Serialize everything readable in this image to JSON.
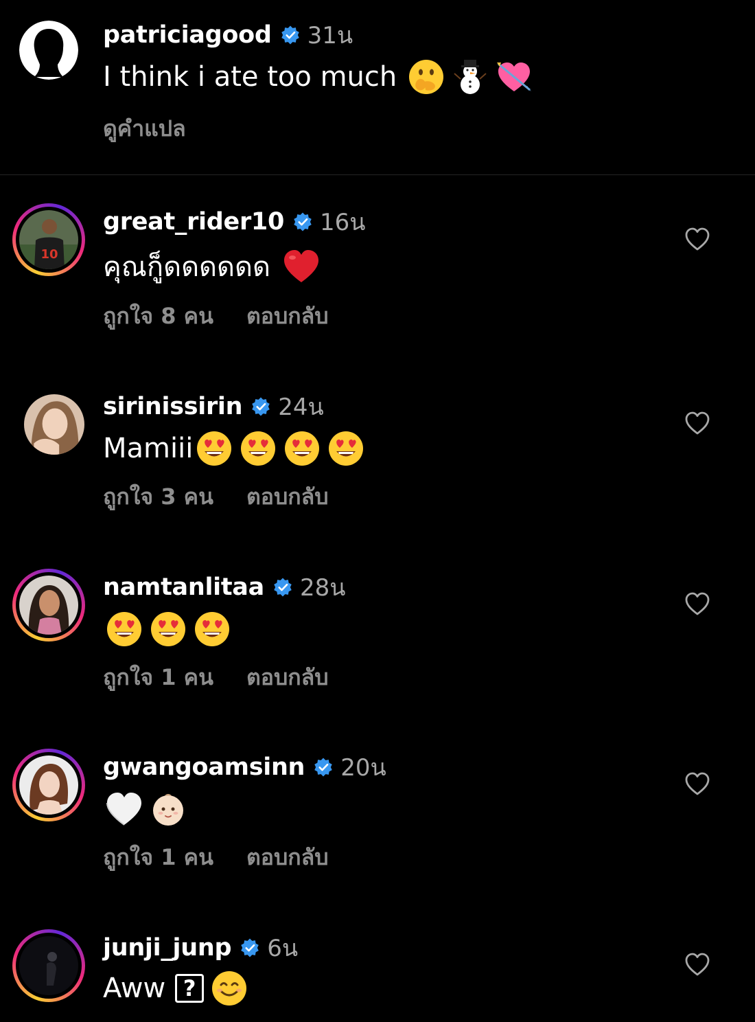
{
  "caption": {
    "username": "patriciagood",
    "time": "31น",
    "text": "I think i ate too much",
    "emojis": [
      "face-with-hand-over-mouth-emoji",
      "snowman-emoji",
      "heart-with-arrow-emoji"
    ],
    "translate_label": "ดูคำแปล"
  },
  "comments": [
    {
      "username": "great_rider10",
      "time": "16น",
      "text": "คุณกู็ดดดดดด",
      "emojis": [
        "red-heart-emoji"
      ],
      "likes_label": "ถูกใจ 8 คน",
      "reply_label": "ตอบกลับ"
    },
    {
      "username": "sirinissirin",
      "time": "24น",
      "text": "Mamiii",
      "emojis": [
        "heart-eyes-emoji",
        "heart-eyes-emoji",
        "heart-eyes-emoji",
        "heart-eyes-emoji"
      ],
      "likes_label": "ถูกใจ 3 คน",
      "reply_label": "ตอบกลับ"
    },
    {
      "username": "namtanlitaa",
      "time": "28น",
      "text": "",
      "emojis": [
        "heart-eyes-emoji",
        "heart-eyes-emoji",
        "heart-eyes-emoji"
      ],
      "likes_label": "ถูกใจ 1 คน",
      "reply_label": "ตอบกลับ"
    },
    {
      "username": "gwangoamsinn",
      "time": "20น",
      "text": "",
      "emojis": [
        "white-heart-emoji",
        "baby-face-emoji"
      ],
      "likes_label": "ถูกใจ 1 คน",
      "reply_label": "ตอบกลับ"
    },
    {
      "username": "junji_junp",
      "time": "6น",
      "text": "Aww",
      "unknown_glyph": "?",
      "emojis": [
        "smiling-face-emoji"
      ]
    }
  ],
  "colors": {
    "background": "#000000",
    "secondary_text": "#8e8e8e",
    "timestamp": "#a8a8a8",
    "verified": "#3897f0"
  }
}
